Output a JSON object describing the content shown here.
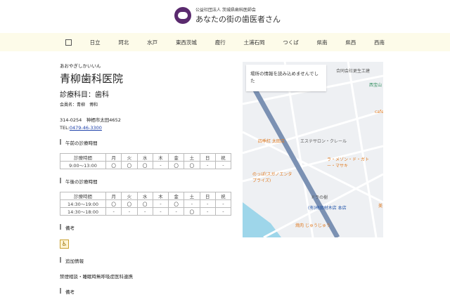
{
  "header": {
    "org": "公益社団法人 茨城県歯科医師会",
    "tagline": "あなたの街の歯医者さん"
  },
  "nav": {
    "items": [
      "日立",
      "珂北",
      "水戸",
      "東西茨城",
      "鹿行",
      "土浦石岡",
      "つくば",
      "県南",
      "県西",
      "西南"
    ]
  },
  "clinic": {
    "kana": "あおやぎしかいいん",
    "name": "青柳歯科医院",
    "dept": "診療科目：歯科",
    "member": "会員名：青柳　博和",
    "address": "314-0254　神栖市太田4652",
    "tel_label": "TEL:",
    "tel": "0479-46-3300"
  },
  "morning": {
    "title": "午前の診療時間",
    "header": [
      "診療時間",
      "月",
      "火",
      "水",
      "木",
      "金",
      "土",
      "日",
      "祝"
    ],
    "rows": [
      [
        "9:00～13:00",
        "〇",
        "〇",
        "〇",
        "-",
        "〇",
        "〇",
        "-",
        "-"
      ]
    ]
  },
  "afternoon": {
    "title": "午後の診療時間",
    "header": [
      "診療時間",
      "月",
      "火",
      "水",
      "木",
      "金",
      "土",
      "日",
      "祝"
    ],
    "rows": [
      [
        "14:30～19:00",
        "〇",
        "〇",
        "〇",
        "-",
        "〇",
        "-",
        "-",
        "-"
      ],
      [
        "14:30～18:00",
        "-",
        "-",
        "-",
        "-",
        "-",
        "〇",
        "-",
        "-"
      ]
    ]
  },
  "notes": {
    "title": "備考",
    "icon": "wheelchair-icon"
  },
  "extra": {
    "title": "追加情報",
    "text": "禁煙相談・睡眠時無呼吸症医科連携"
  },
  "notes2": {
    "title": "備考"
  },
  "map": {
    "error": "場所の情報を読み込めませんでした",
    "pois": [
      "合同会社更生工建",
      "西宝山",
      "cafe",
      "四季紅 太田店",
      "エステサロン・クレール",
      "ラ・メゾン・ド・ガトー・マサキ",
      "のっぽ(スガノエンタプライズ)",
      "ドラの樹",
      "(有)梅田材木店 本店",
      "焼肉 じゅうじゅう",
      "美"
    ]
  }
}
